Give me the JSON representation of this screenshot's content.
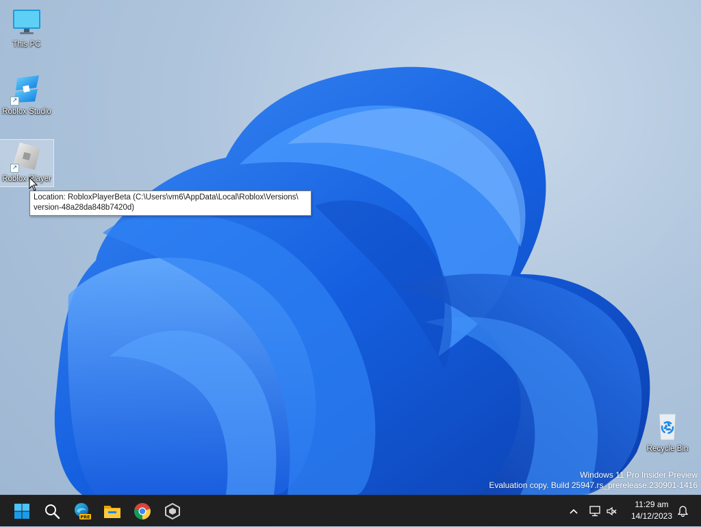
{
  "desktop": {
    "icons": [
      {
        "label": "This PC",
        "icon": "monitor-icon"
      },
      {
        "label": "Roblox Studio",
        "icon": "roblox-studio-icon"
      },
      {
        "label": "Roblox Player",
        "icon": "roblox-player-icon"
      },
      {
        "label": "Recycle Bin",
        "icon": "recycle-bin-icon"
      }
    ]
  },
  "tooltip": {
    "line1": "Location: RobloxPlayerBeta (C:\\Users\\vm6\\AppData\\Local\\Roblox\\Versions\\",
    "line2": "version-48a28da848b7420d)"
  },
  "watermark": {
    "line1": "Windows 11 Pro Insider Preview",
    "line2": "Evaluation copy. Build 25947.rs_prerelease.230901-1416"
  },
  "taskbar": {
    "apps": [
      "start-icon",
      "search-icon",
      "edge-preview-icon",
      "file-explorer-icon",
      "chrome-icon",
      "roblox-studio-taskbar-icon"
    ],
    "edge_badge": "PRE",
    "time": "11:29 am",
    "date": "14/12/2023"
  },
  "colors": {
    "accent": "#0078d4",
    "taskbar": "#202020",
    "bloom": "#1a64e6"
  }
}
